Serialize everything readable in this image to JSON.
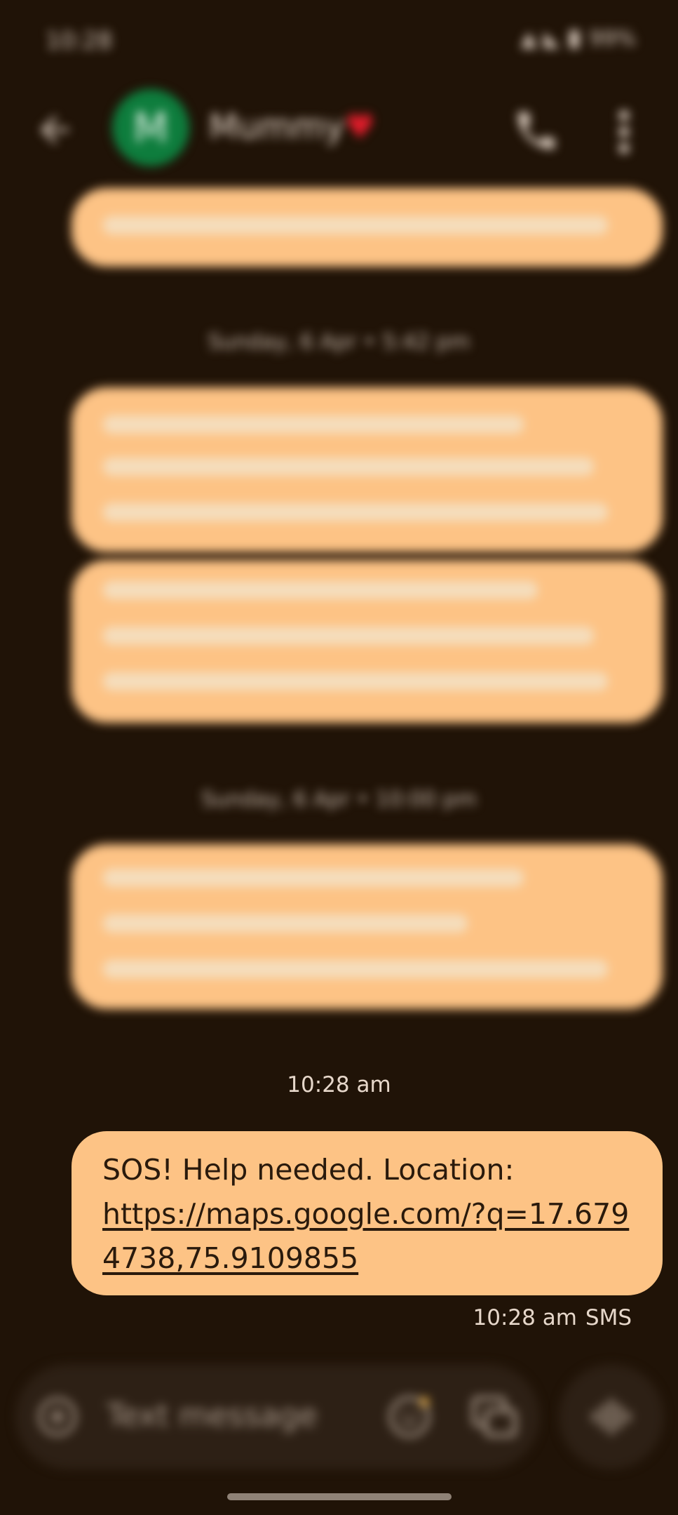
{
  "status_bar": {
    "time": "10:28",
    "battery": "99%"
  },
  "conversation": {
    "contact_name": "Mummy",
    "contact_initial": "M",
    "heart": "♥"
  },
  "timestamps": [
    "Sunday, 6 Apr • 5:42 pm",
    "Sunday, 6 Apr • 10:00 pm"
  ],
  "latest": {
    "time_header": "10:28 am",
    "text": "SOS! Help needed. Location:",
    "link": "https://maps.google.com/?q=17.6794738,75.9109855",
    "time": "10:28 am",
    "type": "SMS"
  },
  "composer": {
    "placeholder": "Text message"
  },
  "colors": {
    "background": "#201307",
    "bubble": "#fdc385",
    "avatar": "#0e7d3d"
  },
  "icons": [
    "back-arrow-icon",
    "phone-icon",
    "more-vert-icon",
    "add-circle-icon",
    "emoji-icon",
    "gallery-icon",
    "voice-icon"
  ]
}
